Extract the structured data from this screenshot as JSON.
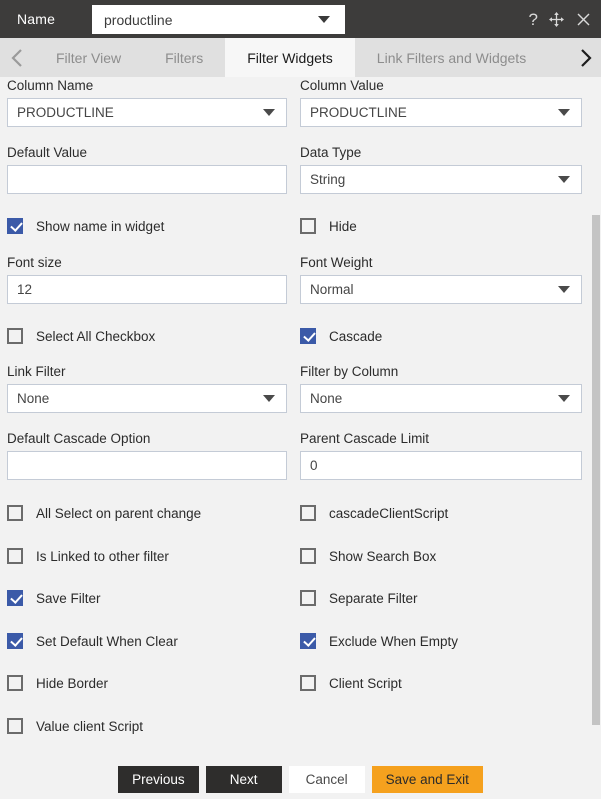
{
  "titlebar": {
    "name_label": "Name",
    "name_value": "productline",
    "help_icon": "question-mark-icon",
    "move_icon": "move-icon",
    "close_icon": "close-icon"
  },
  "tabbar": {
    "prev_icon": "chevron-left-icon",
    "next_icon": "chevron-right-icon",
    "tabs": [
      {
        "label": "Filter View",
        "active": false
      },
      {
        "label": "Filters",
        "active": false
      },
      {
        "label": "Filter Widgets",
        "active": true
      },
      {
        "label": "Link Filters and Widgets",
        "active": false
      }
    ]
  },
  "form": {
    "column_name": {
      "label": "Column Name",
      "value": "PRODUCTLINE",
      "type": "select"
    },
    "column_value": {
      "label": "Column Value",
      "value": "PRODUCTLINE",
      "type": "select"
    },
    "default_value": {
      "label": "Default Value",
      "value": "",
      "type": "text"
    },
    "data_type": {
      "label": "Data Type",
      "value": "String",
      "type": "select"
    },
    "font_size": {
      "label": "Font size",
      "value": "12",
      "type": "text"
    },
    "font_weight": {
      "label": "Font Weight",
      "value": "Normal",
      "type": "select"
    },
    "link_filter": {
      "label": "Link Filter",
      "value": "None",
      "type": "select"
    },
    "filter_by_column": {
      "label": "Filter by Column",
      "value": "None",
      "type": "select"
    },
    "default_cascade_option": {
      "label": "Default Cascade Option",
      "value": "",
      "type": "text"
    },
    "parent_cascade_limit": {
      "label": "Parent Cascade Limit",
      "value": "0",
      "type": "text"
    }
  },
  "checkboxes": {
    "show_name_in_widget": {
      "label": "Show name in widget",
      "checked": true
    },
    "hide": {
      "label": "Hide",
      "checked": false
    },
    "select_all_checkbox": {
      "label": "Select All Checkbox",
      "checked": false
    },
    "cascade": {
      "label": "Cascade",
      "checked": true
    },
    "all_select_on_parent_change": {
      "label": "All Select on parent change",
      "checked": false
    },
    "cascade_client_script": {
      "label": "cascadeClientScript",
      "checked": false
    },
    "is_linked_to_other_filter": {
      "label": "Is Linked to other filter",
      "checked": false
    },
    "show_search_box": {
      "label": "Show Search Box",
      "checked": false
    },
    "save_filter": {
      "label": "Save Filter",
      "checked": true
    },
    "separate_filter": {
      "label": "Separate Filter",
      "checked": false
    },
    "set_default_when_clear": {
      "label": "Set Default When Clear",
      "checked": true
    },
    "exclude_when_empty": {
      "label": "Exclude When Empty",
      "checked": true
    },
    "hide_border": {
      "label": "Hide Border",
      "checked": false
    },
    "client_script": {
      "label": "Client Script",
      "checked": false
    },
    "value_client_script": {
      "label": "Value client Script",
      "checked": false
    }
  },
  "footer": {
    "previous": "Previous",
    "next": "Next",
    "cancel": "Cancel",
    "save_and_exit": "Save and Exit"
  },
  "colors": {
    "titlebar_bg": "#3d3c3b",
    "tabbar_bg": "#e0e0e0",
    "active_tab_bg": "#f7f7f7",
    "body_bg": "#f2f2f2",
    "checkbox_checked": "#3b5aa8",
    "accent_button": "#f5a11e",
    "dark_button": "#2e2d2c"
  }
}
